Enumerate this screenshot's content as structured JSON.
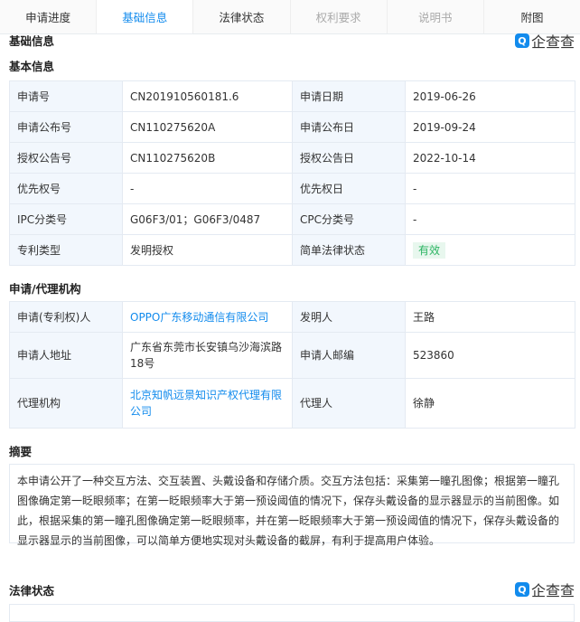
{
  "tabs": [
    {
      "label": "申请进度",
      "state": "normal"
    },
    {
      "label": "基础信息",
      "state": "active"
    },
    {
      "label": "法律状态",
      "state": "normal"
    },
    {
      "label": "权利要求",
      "state": "disabled"
    },
    {
      "label": "说明书",
      "state": "disabled"
    },
    {
      "label": "附图",
      "state": "normal"
    }
  ],
  "section_title": "基础信息",
  "logo_text": "企查查",
  "basic": {
    "title": "基本信息",
    "rows": [
      [
        "申请号",
        "CN201910560181.6",
        "申请日期",
        "2019-06-26"
      ],
      [
        "申请公布号",
        "CN110275620A",
        "申请公布日",
        "2019-09-24"
      ],
      [
        "授权公告号",
        "CN110275620B",
        "授权公告日",
        "2022-10-14"
      ],
      [
        "优先权号",
        "-",
        "优先权日",
        "-"
      ],
      [
        "IPC分类号",
        "G06F3/01；G06F3/0487",
        "CPC分类号",
        "-"
      ],
      [
        "专利类型",
        "发明授权",
        "简单法律状态",
        "有效"
      ]
    ]
  },
  "agency": {
    "title": "申请/代理机构",
    "rows": [
      [
        "申请(专利权)人",
        "OPPO广东移动通信有限公司",
        "发明人",
        "王路"
      ],
      [
        "申请人地址",
        "广东省东莞市长安镇乌沙海滨路18号",
        "申请人邮编",
        "523860"
      ],
      [
        "代理机构",
        "北京知帆远景知识产权代理有限公司",
        "代理人",
        "徐静"
      ]
    ]
  },
  "abstract": {
    "title": "摘要",
    "text": "本申请公开了一种交互方法、交互装置、头戴设备和存储介质。交互方法包括：采集第一瞳孔图像；根据第一瞳孔图像确定第一眨眼频率；在第一眨眼频率大于第一预设阈值的情况下，保存头戴设备的显示器显示的当前图像。如此，根据采集的第一瞳孔图像确定第一眨眼频率，并在第一眨眼频率大于第一预设阈值的情况下，保存头戴设备的显示器显示的当前图像，可以简单方便地实现对头戴设备的截屏，有利于提高用户体验。"
  },
  "legal_status_title": "法律状态",
  "colors": {
    "accent": "#128bed",
    "valid": "#2db563"
  }
}
